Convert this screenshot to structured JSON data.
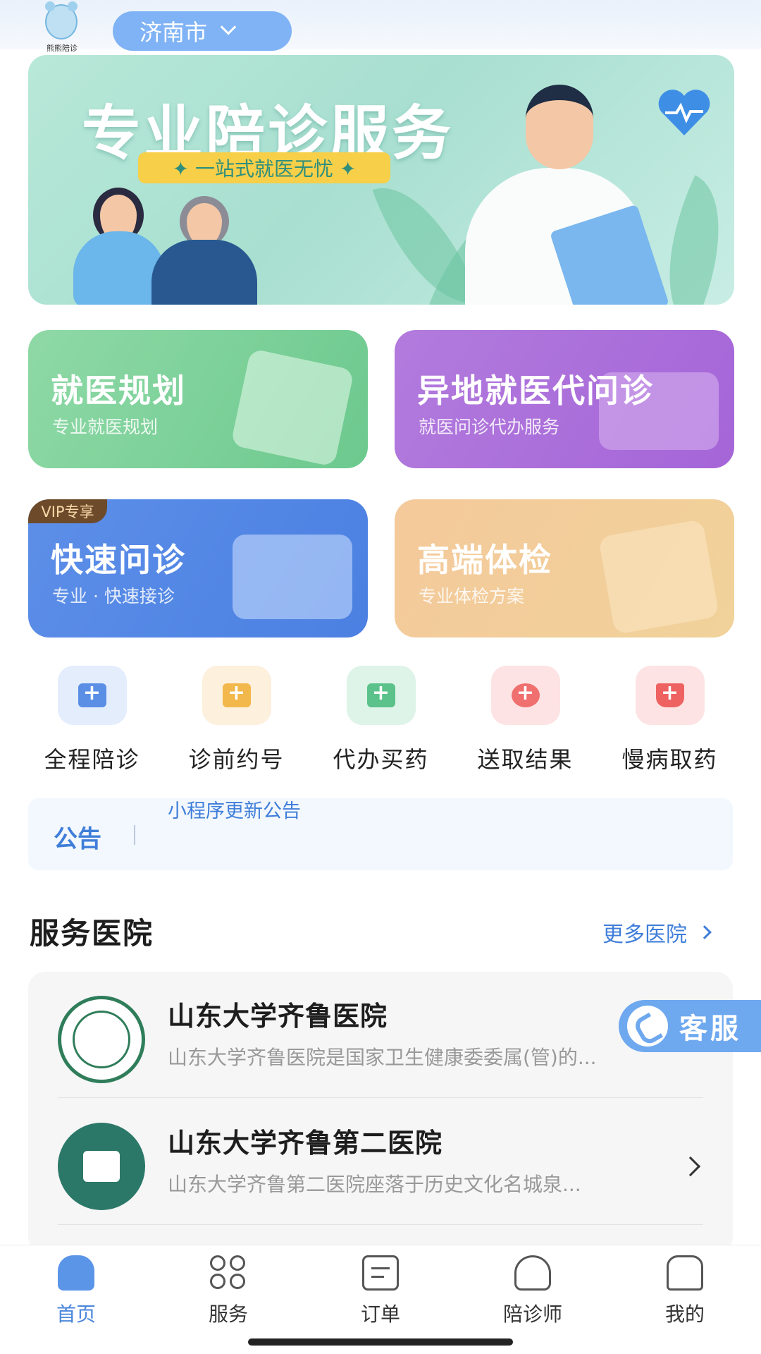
{
  "header": {
    "logo_text": "熊熊陪诊",
    "city": "济南市"
  },
  "banner": {
    "title": "专业陪诊服务",
    "subtitle": "✦ 一站式就医无忧 ✦"
  },
  "cards": [
    {
      "title": "就医规划",
      "subtitle": "专业就医规划"
    },
    {
      "title": "异地就医代问诊",
      "subtitle": "就医问诊代办服务"
    },
    {
      "title": "快速问诊",
      "subtitle": "专业 · 快速接诊",
      "badge": "VIP专享"
    },
    {
      "title": "高端体检",
      "subtitle": "专业体检方案"
    }
  ],
  "services": [
    {
      "label": "全程陪诊",
      "icon": "medical-kit-icon",
      "color": "#5b8fe6"
    },
    {
      "label": "诊前约号",
      "icon": "calendar-icon",
      "color": "#f2b84b"
    },
    {
      "label": "代办买药",
      "icon": "medicine-bottle-icon",
      "color": "#5cc28b"
    },
    {
      "label": "送取结果",
      "icon": "chat-bubble-icon",
      "color": "#f06f6f"
    },
    {
      "label": "慢病取药",
      "icon": "cart-icon",
      "color": "#ef6262"
    }
  ],
  "notice": {
    "label": "公告",
    "text": "小程序更新公告"
  },
  "hospitals": {
    "title": "服务医院",
    "more": "更多医院",
    "items": [
      {
        "name": "山东大学齐鲁医院",
        "desc": "山东大学齐鲁医院是国家卫生健康委委属(管)的..."
      },
      {
        "name": "山东大学齐鲁第二医院",
        "desc": "山东大学齐鲁第二医院座落于历史文化名城泉..."
      }
    ]
  },
  "kefu": "客服",
  "tabs": [
    {
      "label": "首页",
      "active": true
    },
    {
      "label": "服务"
    },
    {
      "label": "订单"
    },
    {
      "label": "陪诊师"
    },
    {
      "label": "我的"
    }
  ]
}
